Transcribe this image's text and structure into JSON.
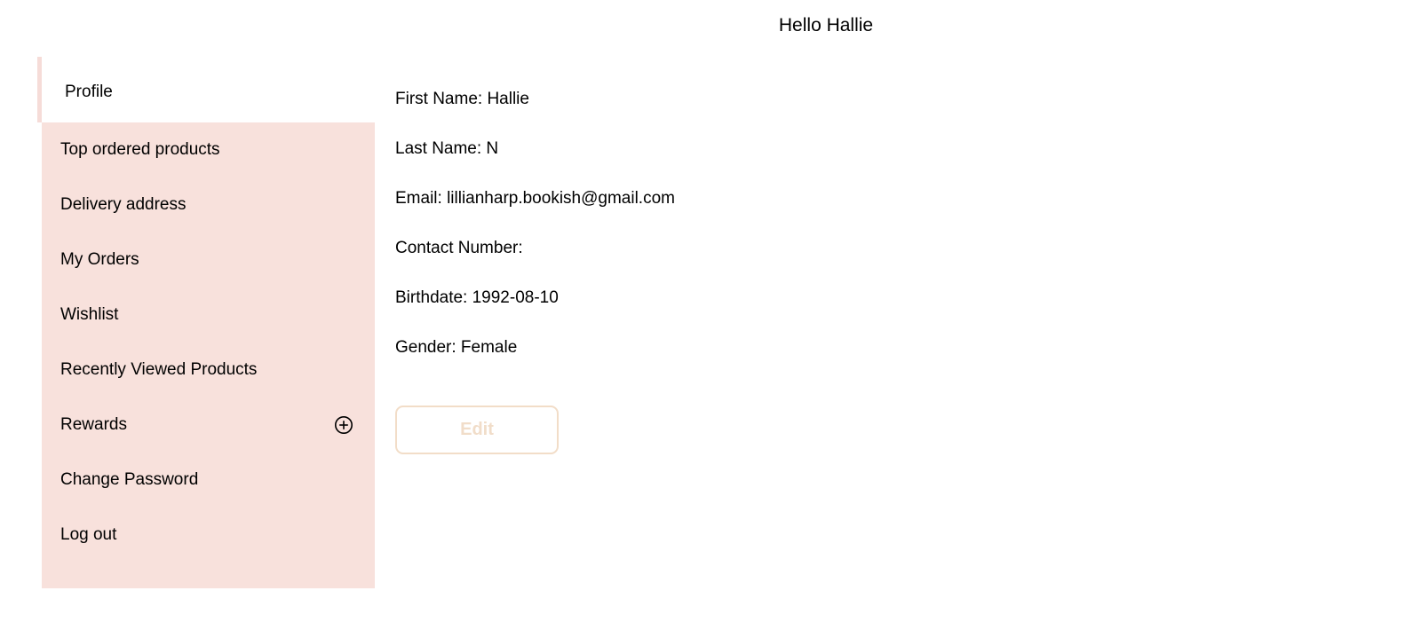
{
  "header": {
    "greeting": "Hello Hallie"
  },
  "sidebar": {
    "items": [
      {
        "label": "Profile",
        "active": true,
        "icon": null
      },
      {
        "label": "Top ordered products",
        "active": false,
        "icon": null
      },
      {
        "label": "Delivery address",
        "active": false,
        "icon": null
      },
      {
        "label": "My Orders",
        "active": false,
        "icon": null
      },
      {
        "label": "Wishlist",
        "active": false,
        "icon": null
      },
      {
        "label": "Recently Viewed Products",
        "active": false,
        "icon": null
      },
      {
        "label": "Rewards",
        "active": false,
        "icon": "plus-circle-icon"
      },
      {
        "label": "Change Password",
        "active": false,
        "icon": null
      },
      {
        "label": "Log out",
        "active": false,
        "icon": null
      }
    ]
  },
  "profile": {
    "rows": [
      {
        "label": "First Name:",
        "value": "Hallie",
        "text": "First Name: Hallie"
      },
      {
        "label": "Last Name:",
        "value": "N",
        "text": "Last Name: N"
      },
      {
        "label": "Email:",
        "value": "lillianharp.bookish@gmail.com",
        "text": "Email: lillianharp.bookish@gmail.com"
      },
      {
        "label": "Contact Number:",
        "value": "",
        "text": "Contact Number:"
      },
      {
        "label": "Birthdate:",
        "value": "1992-08-10",
        "text": "Birthdate: 1992-08-10"
      },
      {
        "label": "Gender:",
        "value": "Female",
        "text": "Gender: Female"
      }
    ],
    "edit_label": "Edit"
  },
  "colors": {
    "sidebar_background": "#f8e1dc",
    "sidebar_accent_bar": "#f6dcd8",
    "active_item_background": "#ffffff",
    "page_background": "#ffffff",
    "text": "#000000",
    "edit_button_border": "#f2ddc8",
    "edit_button_text": "#f1ddc9"
  }
}
